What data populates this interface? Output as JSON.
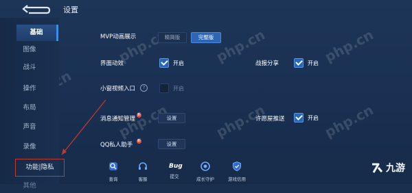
{
  "header": {
    "title": "设置"
  },
  "sidebar": {
    "items": [
      {
        "label": "基础",
        "active": true
      },
      {
        "label": "图像"
      },
      {
        "label": "战斗"
      },
      {
        "label": "操作"
      },
      {
        "label": "布局"
      },
      {
        "label": "声音"
      },
      {
        "label": "录像"
      },
      {
        "label": "功能|隐私",
        "highlight": true
      },
      {
        "label": "其他"
      }
    ]
  },
  "settings": {
    "mvp": {
      "label": "MVP动画展示",
      "options": [
        "精简版",
        "完整版"
      ],
      "selected": "完整版"
    },
    "interface_effects": {
      "label": "界面动效",
      "checkbox_label": "开启",
      "checked": true
    },
    "battle_share": {
      "label": "战报分享",
      "checkbox_label": "开启",
      "checked": true
    },
    "mini_video": {
      "label": "小窗视频入口",
      "checkbox_label": "开启",
      "checked": false
    },
    "notification": {
      "label": "消息通知管理",
      "badge": "新",
      "button": "设置"
    },
    "permission_push": {
      "label": "许愿屋推送",
      "checkbox_label": "开启",
      "checked": true
    },
    "qq_assistant": {
      "label": "QQ私人助手",
      "badge": "新",
      "button": "设置"
    }
  },
  "bottom_bar": [
    {
      "label": "查询",
      "icon": "search-icon"
    },
    {
      "label": "客服",
      "icon": "headset-icon"
    },
    {
      "label": "提交",
      "icon": "bug-icon"
    },
    {
      "label": "成长守护",
      "icon": "growth-icon"
    },
    {
      "label": "游戏信用",
      "icon": "shield-icon"
    }
  ],
  "watermark": "php.cn",
  "colors": {
    "accent": "#2e66b4",
    "highlight_border": "#c8372d"
  }
}
